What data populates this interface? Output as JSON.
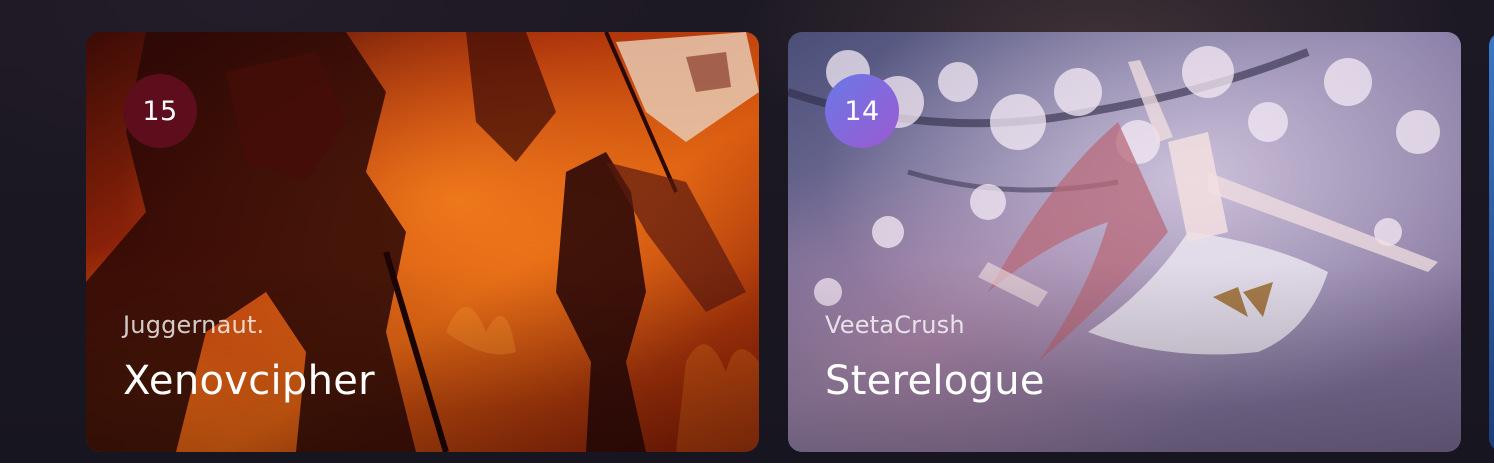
{
  "cards": [
    {
      "rank": "15",
      "artist": "Juggernaut.",
      "title": "Xenovcipher",
      "image": "dark-knight-flames-artwork",
      "badge_color": "#5e0d1c"
    },
    {
      "rank": "14",
      "artist": "VeetaCrush",
      "title": "Sterelogue",
      "image": "cherry-blossom-dancer-artwork",
      "badge_gradient": [
        "#6a78e6",
        "#9c5ad2"
      ]
    },
    {
      "image": "partially-visible-next-card-artwork"
    }
  ],
  "colors": {
    "background": "#191722",
    "text": "#ffffff"
  }
}
